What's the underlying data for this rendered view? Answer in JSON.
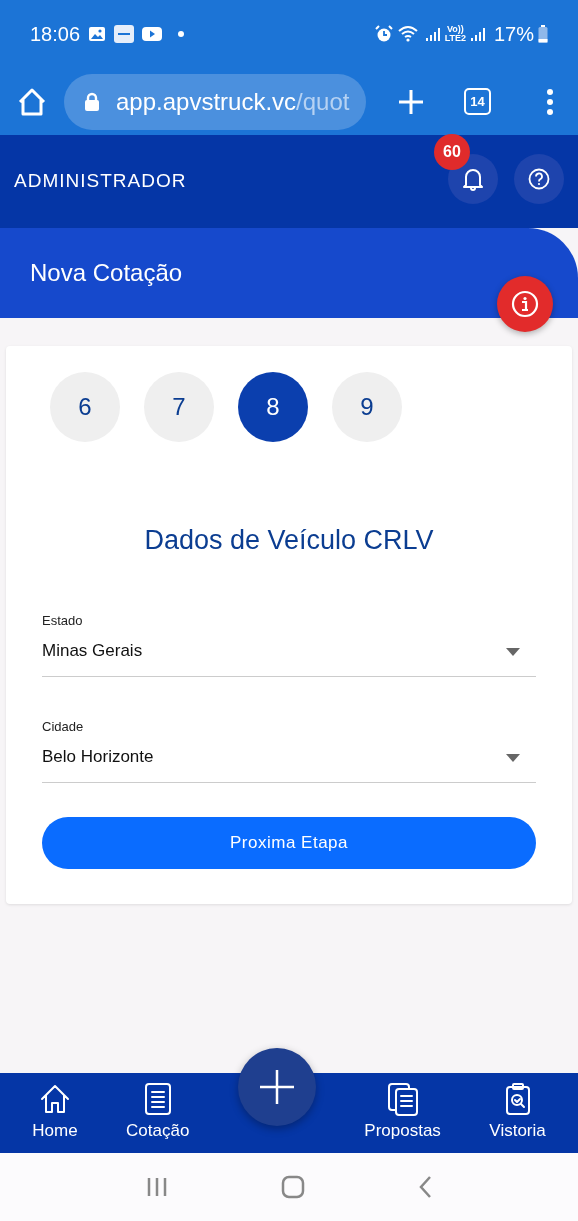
{
  "status_bar": {
    "time": "18:06",
    "network_top": "Vo))",
    "network_bottom": "LTE2",
    "battery": "17%"
  },
  "browser": {
    "url_host": "app.apvstruck.vc",
    "url_path": "/quot",
    "tab_count": "14"
  },
  "header": {
    "title": "ADMINISTRADOR",
    "notification_count": "60"
  },
  "page": {
    "title": "Nova Cotação"
  },
  "steps": [
    {
      "label": "6",
      "selected": false
    },
    {
      "label": "7",
      "selected": false
    },
    {
      "label": "8",
      "selected": true
    },
    {
      "label": "9",
      "selected": false
    }
  ],
  "form": {
    "title": "Dados de Veículo CRLV",
    "fields": [
      {
        "label": "Estado",
        "value": "Minas Gerais"
      },
      {
        "label": "Cidade",
        "value": "Belo Horizonte"
      }
    ],
    "submit": "Proxima Etapa"
  },
  "bottom_nav": [
    {
      "kind": "home",
      "label": "Home"
    },
    {
      "kind": "document",
      "label": "Cotação"
    },
    {
      "kind": "add"
    },
    {
      "kind": "documents",
      "label": "Propostas"
    },
    {
      "kind": "inspection",
      "label": "Vistoria"
    }
  ]
}
